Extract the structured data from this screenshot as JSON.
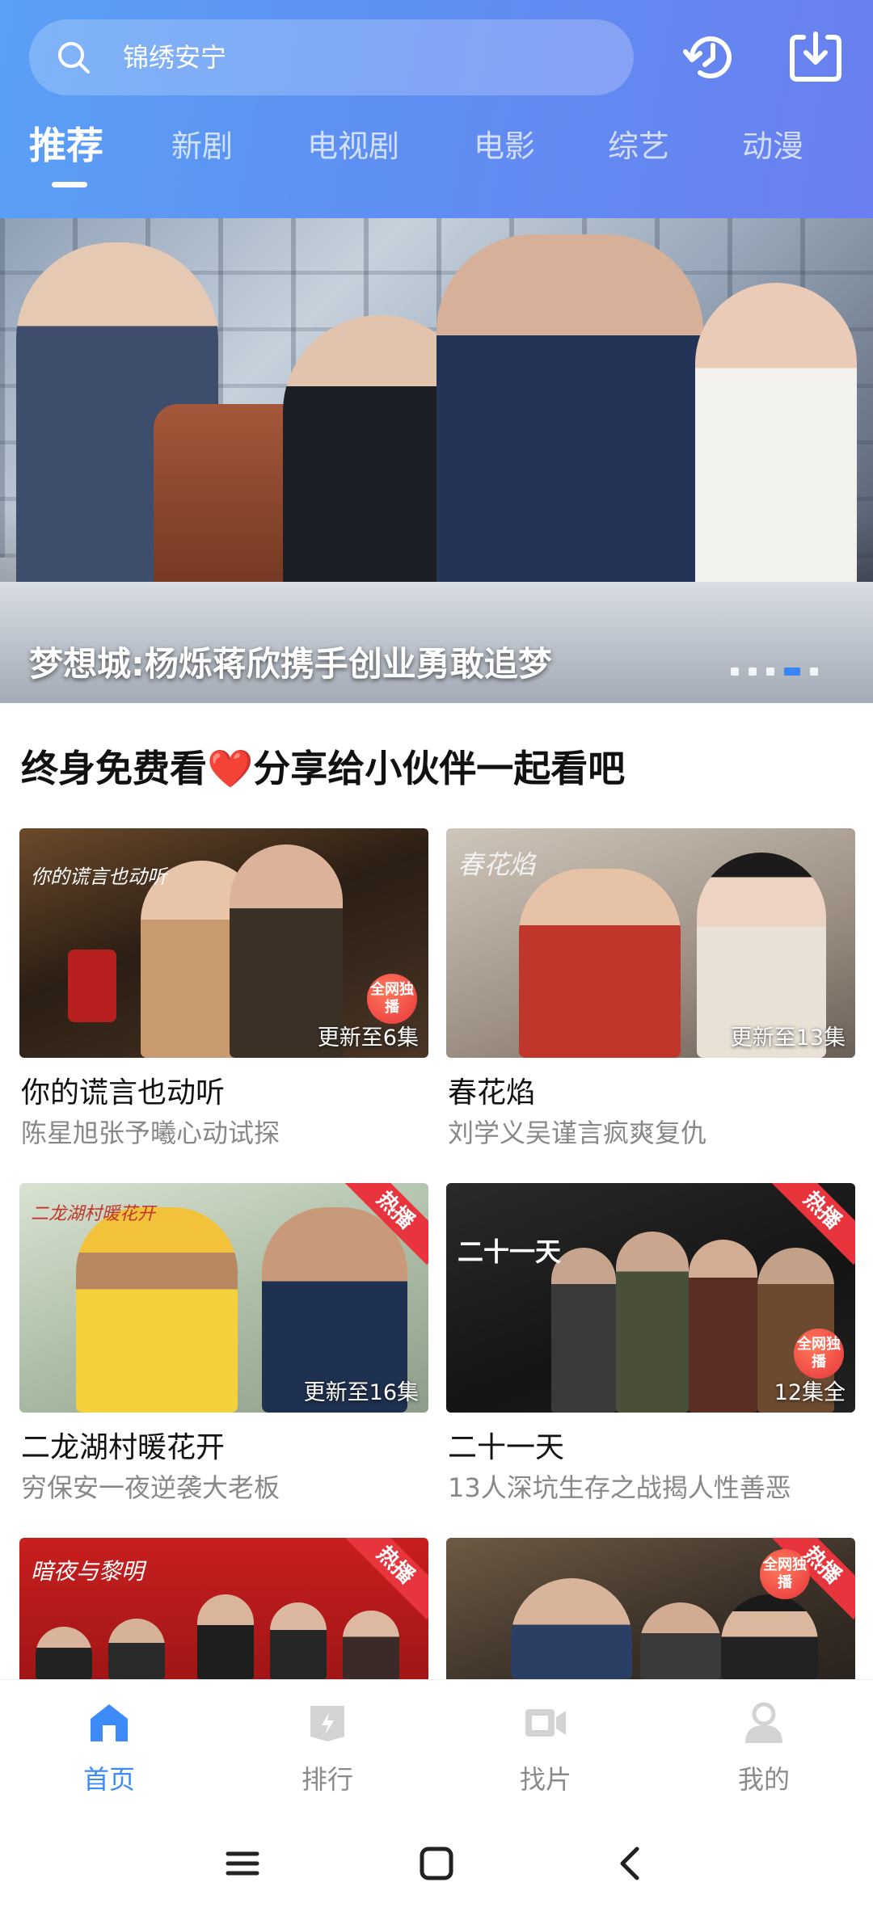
{
  "search": {
    "value": "锦绣安宁"
  },
  "header": {
    "history_icon": "history-icon",
    "download_icon": "download-icon"
  },
  "tabs": [
    {
      "label": "推荐",
      "active": true
    },
    {
      "label": "新剧",
      "active": false
    },
    {
      "label": "电视剧",
      "active": false
    },
    {
      "label": "电影",
      "active": false
    },
    {
      "label": "综艺",
      "active": false
    },
    {
      "label": "动漫",
      "active": false
    }
  ],
  "banner": {
    "caption": "梦想城:杨烁蒋欣携手创业勇敢追梦",
    "slide_count": 5,
    "active_slide": 4
  },
  "section": {
    "title_before": "终身免费看",
    "heart": "❤️",
    "title_after": "分享给小伙伴一起看吧"
  },
  "cards": [
    {
      "title": "你的谎言也动听",
      "subtitle": "陈星旭张予曦心动试探",
      "badge": "更新至6集",
      "hot": "",
      "exclusive": "全网独播",
      "logo": "你的谎言也动听"
    },
    {
      "title": "春花焰",
      "subtitle": "刘学义吴谨言疯爽复仇",
      "badge": "更新至13集",
      "hot": "",
      "exclusive": "",
      "logo": "春花焰"
    },
    {
      "title": "二龙湖村暖花开",
      "subtitle": "穷保安一夜逆袭大老板",
      "badge": "更新至16集",
      "hot": "热播",
      "exclusive": "",
      "logo": "二龙湖村暖花开"
    },
    {
      "title": "二十一天",
      "subtitle": "13人深坑生存之战揭人性善恶",
      "badge": "12集全",
      "hot": "热播",
      "exclusive": "全网独播",
      "logo": "二十一天"
    },
    {
      "title": "",
      "subtitle": "",
      "badge": "",
      "hot": "热播",
      "exclusive": "",
      "logo": "暗夜与黎明"
    },
    {
      "title": "",
      "subtitle": "",
      "badge": "",
      "hot": "热播",
      "exclusive": "全网独播",
      "logo": ""
    }
  ],
  "nav": [
    {
      "label": "首页",
      "icon": "home-icon",
      "active": true
    },
    {
      "label": "排行",
      "icon": "ranking-icon",
      "active": false
    },
    {
      "label": "找片",
      "icon": "video-camera-icon",
      "active": false
    },
    {
      "label": "我的",
      "icon": "profile-icon",
      "active": false
    }
  ],
  "colors": {
    "accent": "#3d8bf7",
    "hot": "#e8343c",
    "header_start": "#5aa0f6",
    "header_end": "#6a7ff0"
  }
}
